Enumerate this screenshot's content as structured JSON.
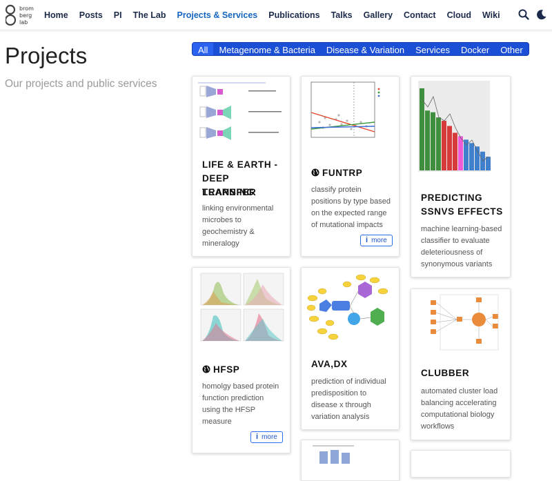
{
  "logo": {
    "lines": [
      "brom",
      "berg",
      "lab"
    ]
  },
  "nav": {
    "items": [
      "Home",
      "Posts",
      "PI",
      "The Lab",
      "Projects & Services",
      "Publications",
      "Talks",
      "Gallery",
      "Contact",
      "Cloud",
      "Wiki"
    ],
    "active": "Projects & Services"
  },
  "header": {
    "title": "Projects",
    "subtitle": "Our projects and public services"
  },
  "filters": {
    "items": [
      "All",
      "Metagenome & Bacteria",
      "Disease & Variation",
      "Services",
      "Docker",
      "Other"
    ],
    "active": "All"
  },
  "cards": [
    {
      "title_lines": [
        "LIFE & EARTH -",
        "DEEP TRANSFER",
        "LEARNING"
      ],
      "desc_lines": [
        "linking environmental",
        "microbes to",
        "geochemistry &",
        "mineralogy"
      ],
      "more": ""
    },
    {
      "title_lines": [
        "FUNTRP"
      ],
      "desc_lines": [
        "classify protein",
        "positions by type based",
        "on the expected range",
        "of mutational impacts"
      ],
      "more": "more"
    },
    {
      "title_lines": [
        "PREDICTING",
        "SSNVS EFFECTS"
      ],
      "desc_lines": [
        "machine learning-based",
        "classifier to evaluate",
        "deleteriousness of",
        "synonymous variants"
      ],
      "more": ""
    },
    {
      "title_lines": [
        "HFSP"
      ],
      "desc_lines": [
        "homolgy based protein",
        "function prediction",
        "using the HFSP",
        "measure"
      ],
      "more": "more"
    },
    {
      "title_lines": [
        "AVA,DX"
      ],
      "desc_lines": [
        "prediction of individual",
        "predisposition to",
        "disease x through",
        "variation analysis"
      ],
      "more": ""
    },
    {
      "title_lines": [
        "CLUBBER"
      ],
      "desc_lines": [
        "automated cluster load",
        "balancing accelerating",
        "computational biology",
        "workflows"
      ],
      "more": ""
    }
  ],
  "colors": {
    "accent": "#1a4fd6",
    "nav_text": "#1b2a4a",
    "nav_active": "#1565c0"
  }
}
